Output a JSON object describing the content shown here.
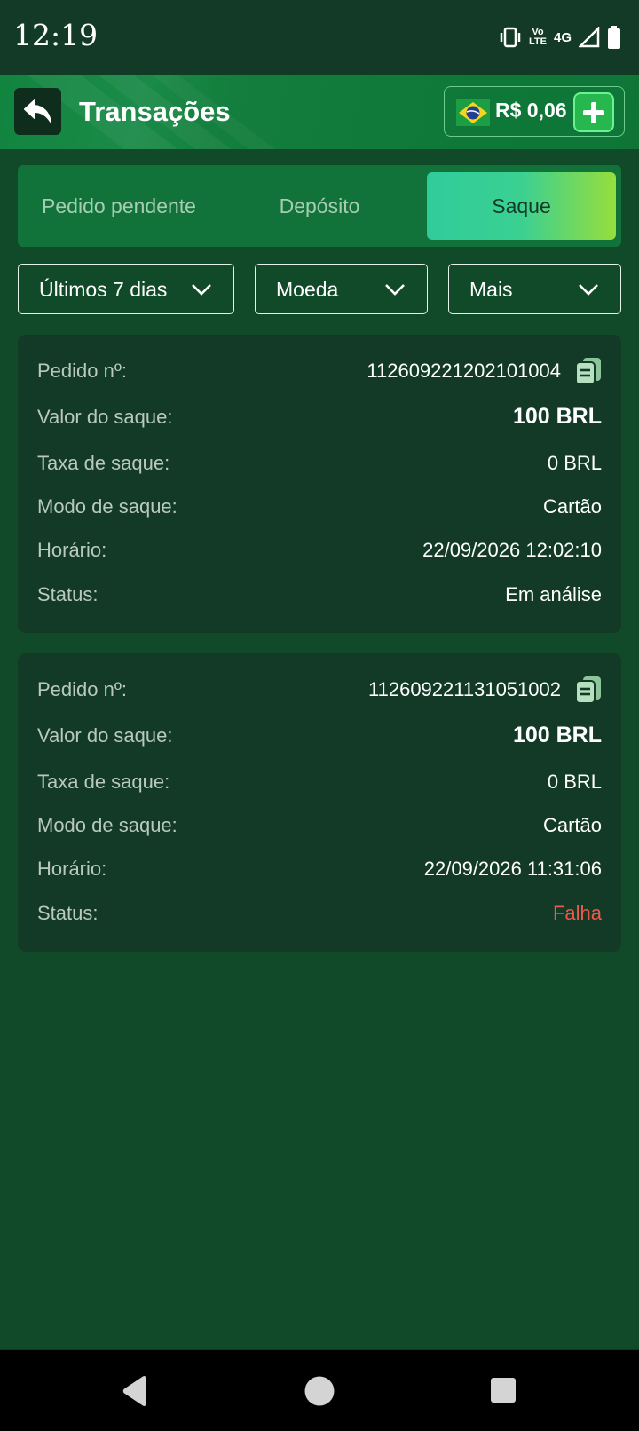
{
  "status_bar": {
    "time": "12:19",
    "lte_line1": "Vo",
    "lte_line2": "LTE",
    "network": "4G",
    "icons": [
      "vibrate-icon",
      "volte-icon",
      "signal-icon",
      "battery-icon"
    ]
  },
  "header": {
    "title": "Transações",
    "balance": "R$ 0,06",
    "back_icon": "back-arrow-icon",
    "flag_icon": "brazil-flag-icon",
    "add_icon": "plus-icon"
  },
  "tabs": [
    {
      "label": "Pedido pendente",
      "selected": false
    },
    {
      "label": "Depósito",
      "selected": false
    },
    {
      "label": "Saque",
      "selected": true
    }
  ],
  "filters": [
    {
      "label": "Últimos 7 dias"
    },
    {
      "label": "Moeda"
    },
    {
      "label": "Mais"
    }
  ],
  "labels": {
    "order": "Pedido nº:",
    "amount": "Valor do saque:",
    "fee": "Taxa de saque:",
    "mode": "Modo de saque:",
    "time": "Horário:",
    "status": "Status:"
  },
  "transactions": [
    {
      "order_no": "112609221202101004",
      "amount": "100 BRL",
      "fee": "0 BRL",
      "mode": "Cartão",
      "time": "22/09/2026 12:02:10",
      "status": "Em análise",
      "status_color": "#ffffff"
    },
    {
      "order_no": "112609221131051002",
      "amount": "100 BRL",
      "fee": "0 BRL",
      "mode": "Cartão",
      "time": "22/09/2026 11:31:06",
      "status": "Falha",
      "status_color": "#f0584b"
    }
  ],
  "colors": {
    "background": "#114a28",
    "card": "#123a26",
    "accent_start": "#2fcc9a",
    "accent_end": "#96de3c",
    "failure": "#f0584b"
  },
  "nav": {
    "back": "nav-back-icon",
    "home": "nav-home-icon",
    "recents": "nav-recents-icon"
  }
}
